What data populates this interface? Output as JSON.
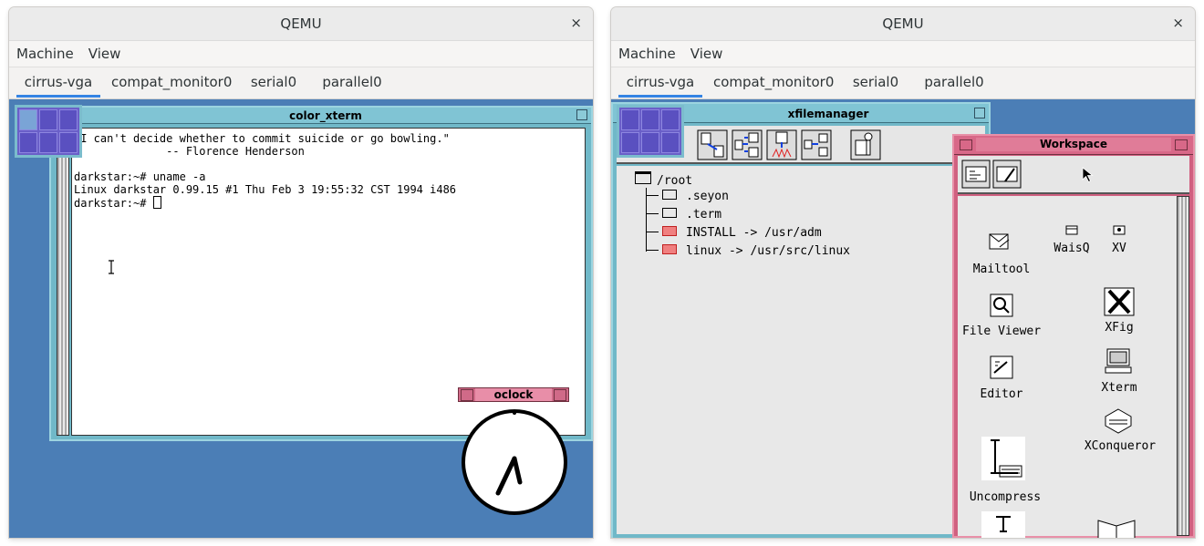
{
  "left": {
    "title": "QEMU",
    "close": "×",
    "menu": [
      "Machine",
      "View"
    ],
    "tabs": [
      "cirrus-vga",
      "compat_monitor0",
      "serial0",
      "parallel0"
    ],
    "xterm": {
      "title": "color_xterm",
      "lines": [
        "\"I can't decide whether to commit suicide or go bowling.\"",
        "              -- Florence Henderson",
        "",
        "darkstar:~# uname -a",
        "Linux darkstar 0.99.15 #1 Thu Feb 3 19:55:32 CST 1994 i486",
        "darkstar:~# "
      ]
    },
    "oclock": {
      "title": "oclock"
    }
  },
  "right": {
    "title": "QEMU",
    "close": "×",
    "menu": [
      "Machine",
      "View"
    ],
    "tabs": [
      "cirrus-vga",
      "compat_monitor0",
      "serial0",
      "parallel0"
    ],
    "xfm": {
      "title": "xfilemanager",
      "tree": [
        "/root",
        ".seyon",
        ".term",
        "INSTALL -> /usr/adm",
        "linux -> /usr/src/linux"
      ]
    },
    "workspace": {
      "title": "Workspace",
      "icons": [
        "Mailtool",
        "WaisQ",
        "XV",
        "File Viewer",
        "XFig",
        "Editor",
        "Xterm",
        "XConqueror",
        "Uncompress"
      ]
    }
  },
  "colors": {
    "desktop": "#4b7eb6",
    "motif": "#70b8c8",
    "workspace": "#d06080",
    "tab_accent": "#3584e4"
  }
}
